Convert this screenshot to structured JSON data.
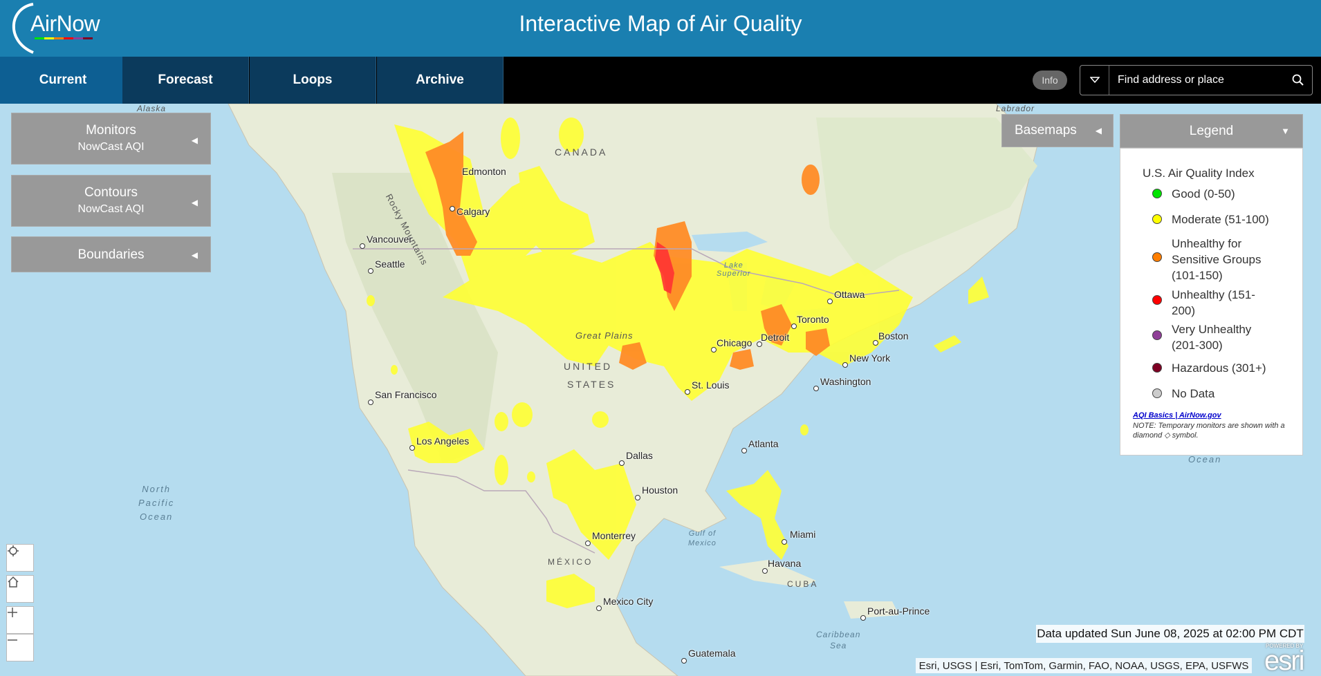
{
  "header": {
    "logo_text": "AirNow",
    "title": "Interactive Map of Air Quality"
  },
  "nav": {
    "tabs": [
      {
        "label": "Current",
        "active": true
      },
      {
        "label": "Forecast",
        "active": false
      },
      {
        "label": "Loops",
        "active": false
      },
      {
        "label": "Archive",
        "active": false
      }
    ],
    "info_label": "Info",
    "search_placeholder": "Find address or place"
  },
  "panels": {
    "monitors": {
      "title": "Monitors",
      "subtitle": "NowCast AQI"
    },
    "contours": {
      "title": "Contours",
      "subtitle": "NowCast AQI"
    },
    "boundaries": {
      "title": "Boundaries"
    },
    "basemaps": {
      "title": "Basemaps"
    }
  },
  "legend": {
    "header": "Legend",
    "title": "U.S. Air Quality Index",
    "items": [
      {
        "label": "Good (0-50)",
        "color": "#00e400"
      },
      {
        "label": "Moderate (51-100)",
        "color": "#ffff00"
      },
      {
        "label": "Unhealthy for Sensitive Groups (101-150)",
        "color": "#ff7e00"
      },
      {
        "label": "Unhealthy (151-200)",
        "color": "#ff0000"
      },
      {
        "label": "Very Unhealthy (201-300)",
        "color": "#8f3f97"
      },
      {
        "label": "Hazardous (301+)",
        "color": "#7e0023"
      },
      {
        "label": "No Data",
        "color": "#cccccc"
      }
    ],
    "link_text": "AQI Basics | AirNow.gov",
    "note": "NOTE: Temporary monitors are shown with a diamond ◇ symbol."
  },
  "map": {
    "cities": [
      "Edmonton",
      "Calgary",
      "Vancouver",
      "Seattle",
      "San Francisco",
      "Los Angeles",
      "Dallas",
      "Houston",
      "Monterrey",
      "Mexico City",
      "Guatemala",
      "Havana",
      "Miami",
      "Atlanta",
      "St. Louis",
      "Chicago",
      "Detroit",
      "Toronto",
      "Ottawa",
      "Boston",
      "New York",
      "Washington",
      "Port-au-Prince"
    ],
    "regions": {
      "canada": "CANADA",
      "united_states_1": "UNITED",
      "united_states_2": "STATES",
      "mexico": "MÉXICO",
      "cuba": "CUBA",
      "rocky": "Rocky Mountains",
      "great_plains": "Great Plains",
      "alaska": "Alaska",
      "labrador": "Labrador"
    },
    "water": {
      "pacific_1": "North",
      "pacific_2": "Pacific",
      "pacific_3": "Ocean",
      "ocean_right": "Ocean",
      "gulf_1": "Gulf of",
      "gulf_2": "Mexico",
      "caribbean_1": "Caribbean",
      "caribbean_2": "Sea",
      "lake_1": "Lake",
      "lake_2": "Superior"
    }
  },
  "status": {
    "updated": "Data updated Sun June 08, 2025 at 02:00 PM CDT",
    "attribution": "Esri, USGS | Esri, TomTom, Garmin, FAO, NOAA, USGS, EPA, USFWS",
    "esri_powered": "POWERED BY",
    "esri_logo": "esri"
  }
}
